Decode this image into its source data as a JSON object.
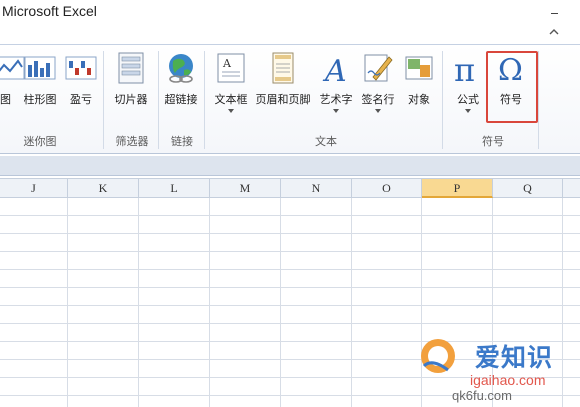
{
  "window": {
    "title": "Microsoft Excel"
  },
  "ribbon": {
    "commands": [
      {
        "key": "sparkline_line",
        "label": "折线图",
        "visible": "线图"
      },
      {
        "key": "sparkline_column",
        "label": "柱形图"
      },
      {
        "key": "sparkline_winloss",
        "label": "盈亏"
      },
      {
        "key": "slicer",
        "label": "切片器"
      },
      {
        "key": "hyperlink",
        "label": "超链接"
      },
      {
        "key": "textbox",
        "label": "文本框"
      },
      {
        "key": "header_footer",
        "label": "页眉和页脚"
      },
      {
        "key": "wordart",
        "label": "艺术字"
      },
      {
        "key": "signature_line",
        "label": "签名行"
      },
      {
        "key": "object",
        "label": "对象"
      },
      {
        "key": "equation",
        "label": "公式"
      },
      {
        "key": "symbol",
        "label": "符号"
      }
    ],
    "groups": {
      "sparklines": "迷你图",
      "filter": "筛选器",
      "links": "链接",
      "text": "文本",
      "symbols": "符号"
    }
  },
  "sheet": {
    "columns": [
      "J",
      "K",
      "L",
      "M",
      "N",
      "O",
      "P",
      "Q"
    ],
    "active_column": "P"
  },
  "watermark": {
    "line1": "爱知识",
    "line2": "igaihao.com",
    "line3": "qk6fu.com"
  },
  "colors": {
    "highlight_border": "#d9463b",
    "active_column": "#f9d992",
    "ribbon_border": "#b9c6d9"
  }
}
